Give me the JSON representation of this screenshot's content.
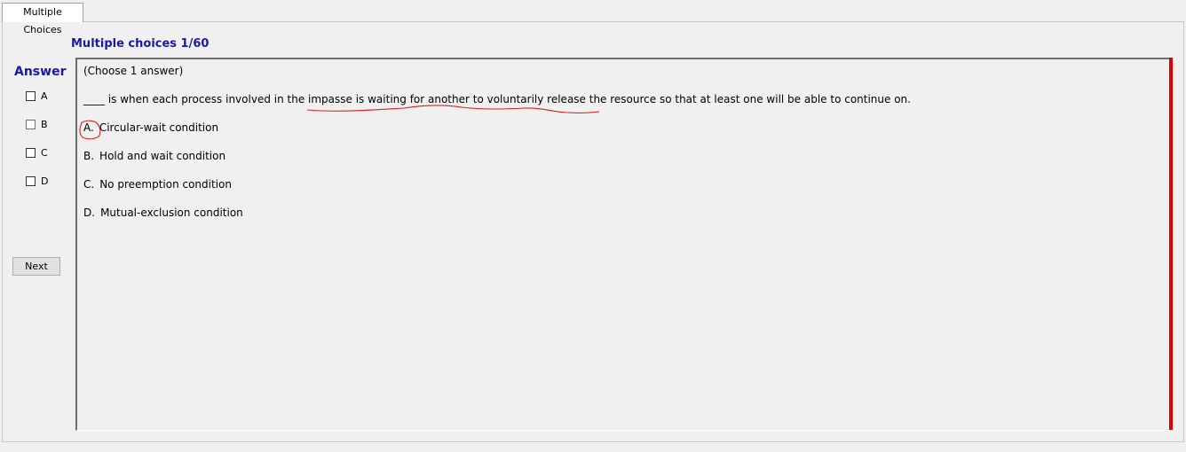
{
  "tab": {
    "label": "Multiple Choices"
  },
  "header": {
    "progress": "Multiple choices 1/60"
  },
  "answer_panel": {
    "title": "Answer",
    "options": [
      {
        "label": "A",
        "checked": false
      },
      {
        "label": "B",
        "checked": false
      },
      {
        "label": "C",
        "checked": false
      },
      {
        "label": "D",
        "checked": false
      }
    ],
    "next_label": "Next"
  },
  "question": {
    "instruction": "(Choose 1 answer)",
    "text": "____ is when each process involved in the impasse is waiting for another to voluntarily release the resource so that at least one will be able to continue on.",
    "choices": [
      {
        "letter": "A.",
        "text": "Circular-wait condition"
      },
      {
        "letter": "B.",
        "text": "Hold and wait condition"
      },
      {
        "letter": "C.",
        "text": "No preemption condition"
      },
      {
        "letter": "D.",
        "text": "Mutual-exclusion condition"
      }
    ]
  },
  "colors": {
    "title_blue": "#1a1aa0",
    "marker_red": "#e00000",
    "annotation_red": "#d62020"
  }
}
